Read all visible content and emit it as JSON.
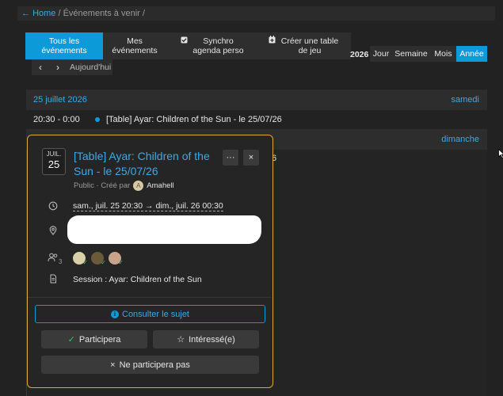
{
  "breadcrumb": {
    "home_arrow": "←",
    "home": "Home",
    "sep1": "/",
    "current": "Événements à venir",
    "sep2": "/"
  },
  "tabs": [
    {
      "label": "Tous les événements",
      "active": true
    },
    {
      "label": "Mes événements",
      "active": false
    },
    {
      "label": "Synchro agenda perso",
      "icon": "checkbox-icon",
      "active": false
    },
    {
      "label": "Créer une table de jeu",
      "icon": "calendar-add-icon",
      "active": false
    }
  ],
  "year": "2026",
  "views": [
    {
      "label": "Jour",
      "active": false
    },
    {
      "label": "Semaine",
      "active": false
    },
    {
      "label": "Mois",
      "active": false
    },
    {
      "label": "Année",
      "active": true
    }
  ],
  "nav": {
    "prev": "‹",
    "next": "›",
    "today": "Aujourd'hui"
  },
  "days": [
    {
      "date": "25 juillet 2026",
      "weekday": "samedi"
    },
    {
      "weekday": "dimanche"
    }
  ],
  "event_row": {
    "time": "20:30 - 0:00",
    "title": "[Table] Ayar: Children of the Sun - le 25/07/26"
  },
  "behind_fragment": "6",
  "popup": {
    "month": "JUIL.",
    "day": "25",
    "title": "[Table] Ayar: Children of the Sun - le 25/07/26",
    "visibility": "Public · Créé par",
    "author_initial": "A",
    "author": "Amahell",
    "more": "···",
    "close": "×",
    "datetime": "sam., juil. 25 20:30 → dim., juil. 26 00:30",
    "guest_count": "3",
    "description": "Session : Ayar: Children of the Sun",
    "consult": "Consulter le sujet",
    "going": "Participera",
    "interested": "Intéressé(e)",
    "not_going": "Ne participera pas",
    "colors": {
      "accent": "#0d9ad9",
      "border": "#e0a92e",
      "check": "#37c06b"
    }
  }
}
